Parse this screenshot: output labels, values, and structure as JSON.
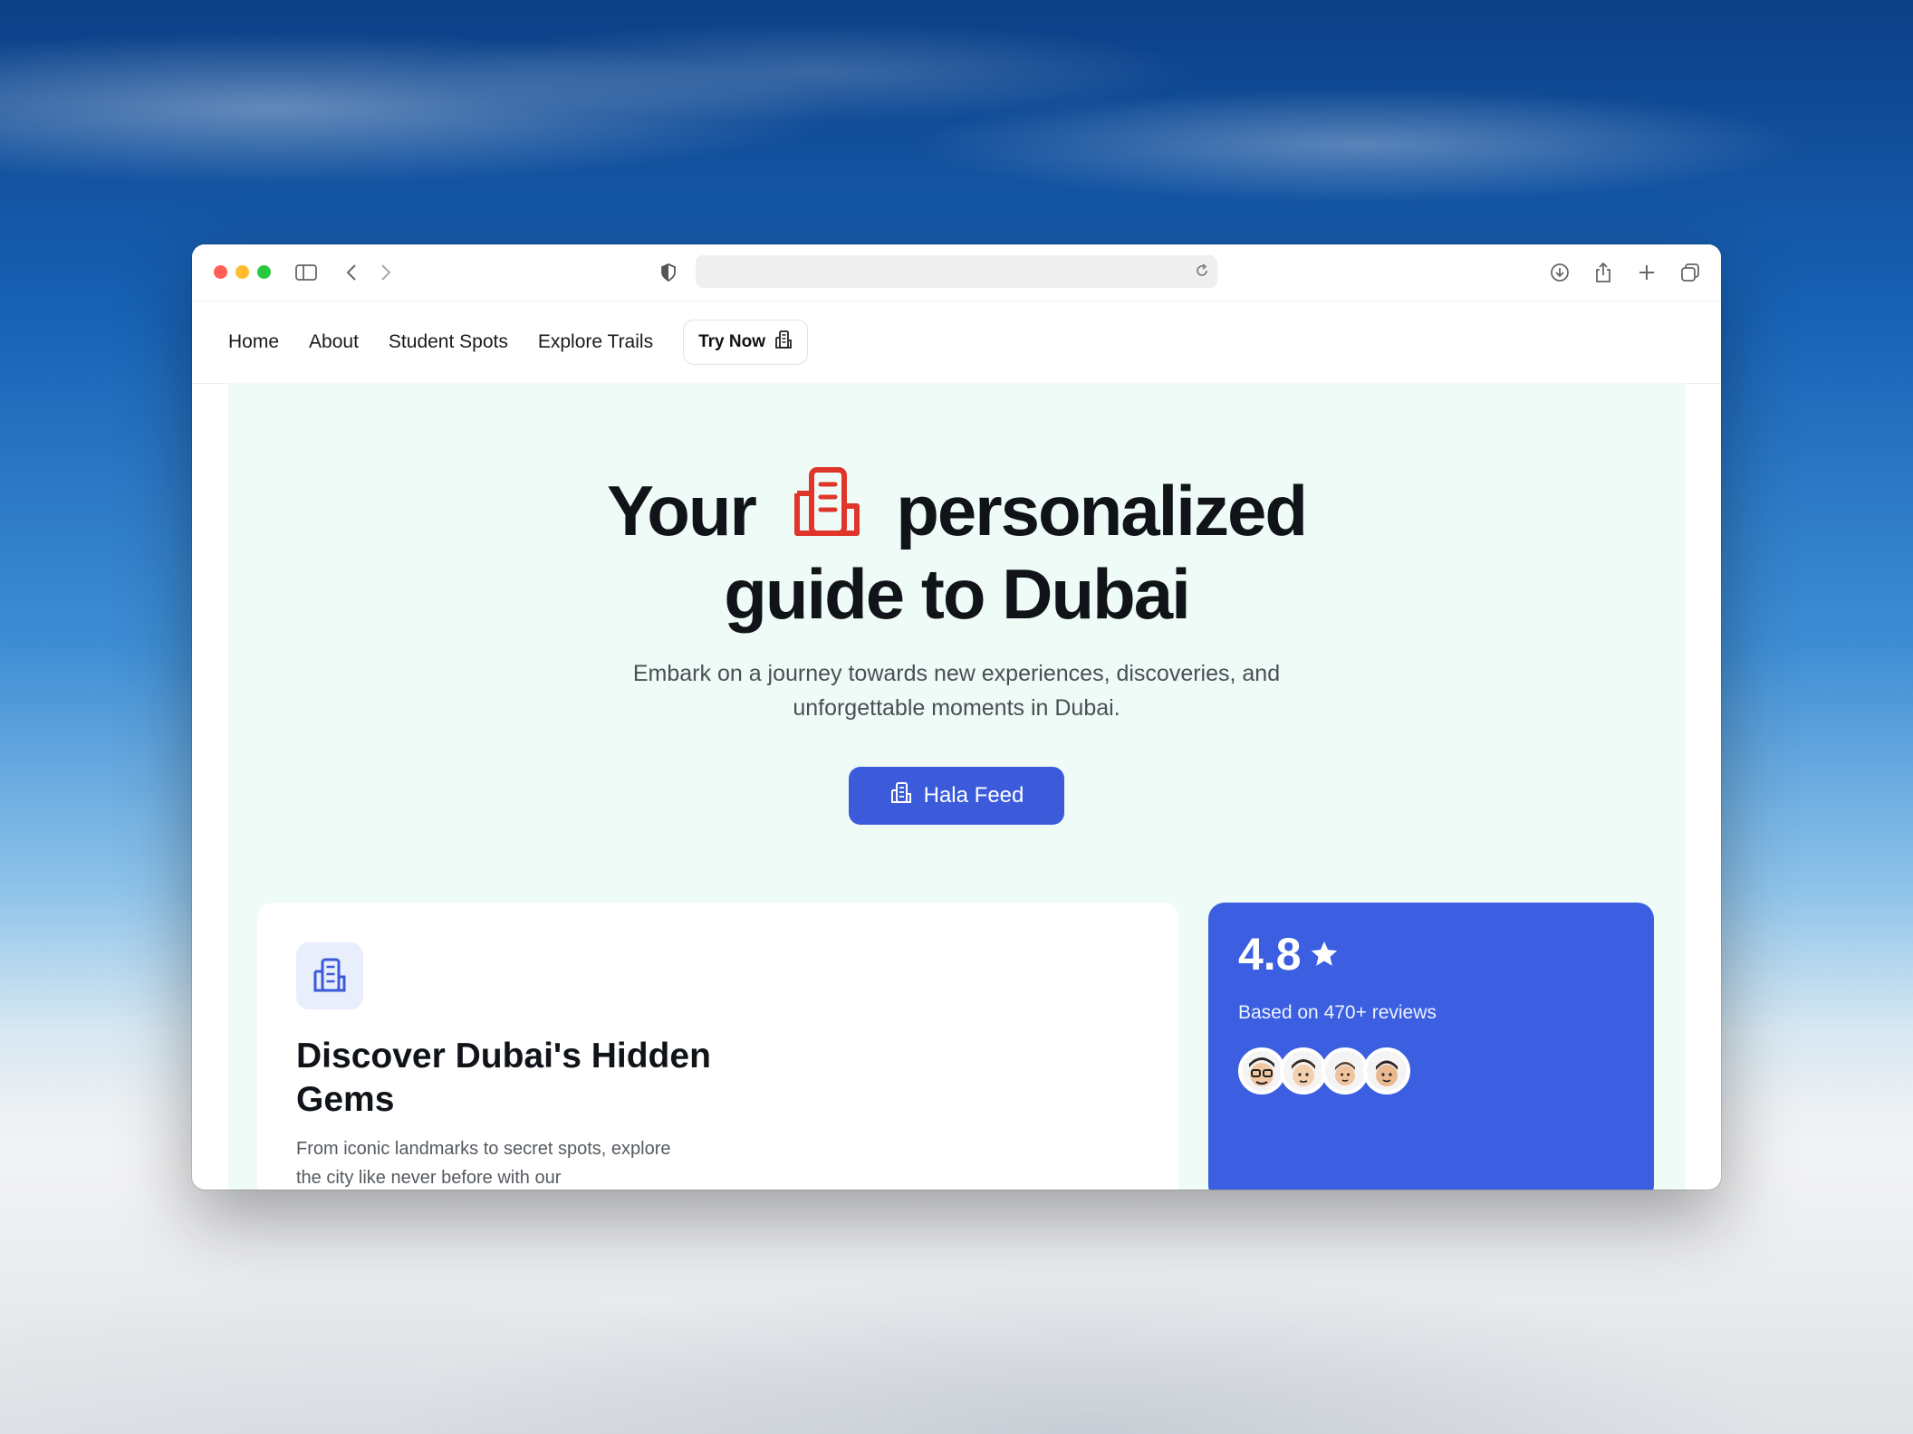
{
  "nav": {
    "items": [
      "Home",
      "About",
      "Student Spots",
      "Explore Trails"
    ],
    "try_label": "Try Now"
  },
  "hero": {
    "title_part1": "Your",
    "title_part2": "personalized",
    "title_part3": "guide to Dubai",
    "subtitle": "Embark on a journey towards new experiences, discoveries, and unforgettable moments in Dubai.",
    "cta_label": "Hala Feed"
  },
  "feature_card": {
    "title": "Discover Dubai's Hidden Gems",
    "text": "From iconic landmarks to secret spots, explore the city like never before with our"
  },
  "rating_card": {
    "rating": "4.8",
    "reviews": "Based on 470+ reviews"
  },
  "colors": {
    "accent": "#3b5bdb",
    "hero_bg": "#effbf6",
    "icon_red": "#e0352b"
  }
}
